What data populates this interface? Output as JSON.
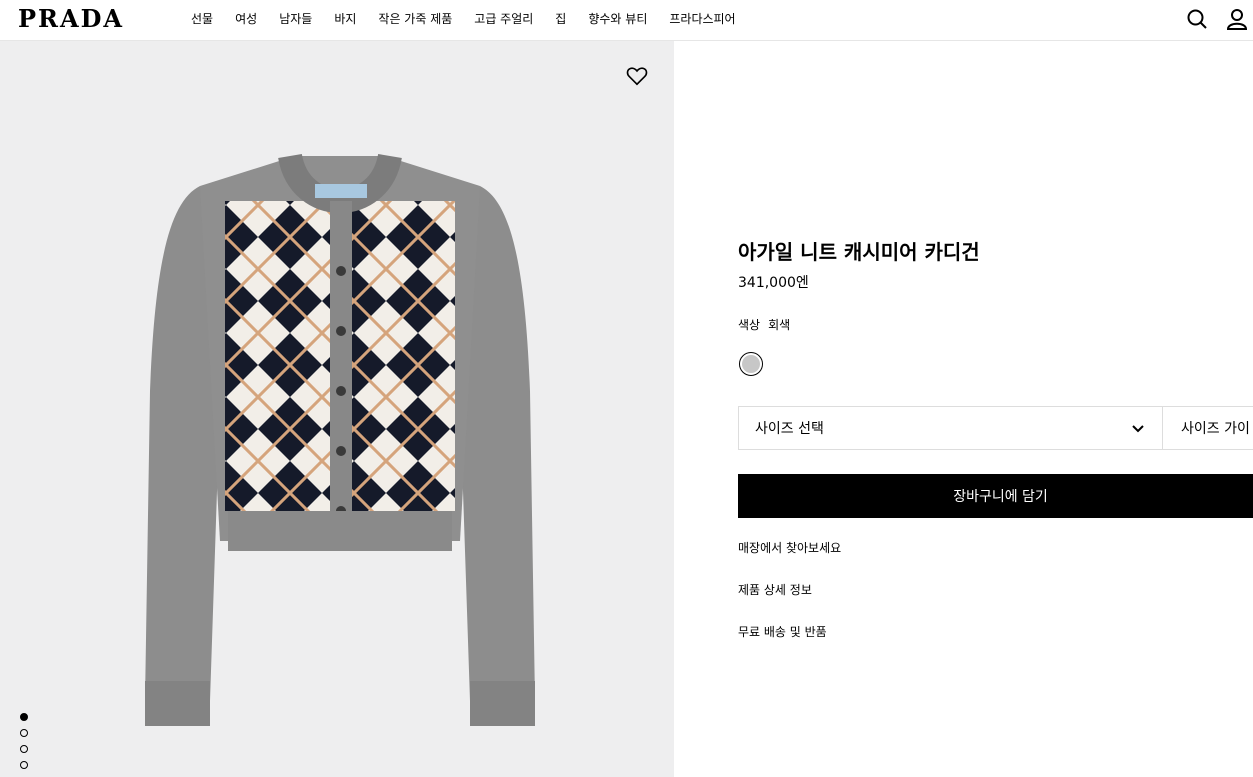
{
  "header": {
    "logo": "PRADA",
    "nav": [
      "선물",
      "여성",
      "남자들",
      "바지",
      "작은 가죽 제품",
      "고급 주얼리",
      "집",
      "향수와 뷰티",
      "프라다스피어"
    ]
  },
  "product": {
    "title": "아가일 니트 캐시미어 카디건",
    "price": "341,000엔",
    "color_label": "색상",
    "color_value": "회색",
    "swatch_color": "#c7c7c7",
    "size_select": "사이즈 선택",
    "size_guide": "사이즈 가이",
    "add_to_cart": "장바구니에 담기",
    "links": [
      "매장에서 찾아보세요",
      "제품 상세 정보",
      "무료 배송 및 반품"
    ]
  },
  "gallery": {
    "image_count": 4,
    "active_index": 0
  }
}
